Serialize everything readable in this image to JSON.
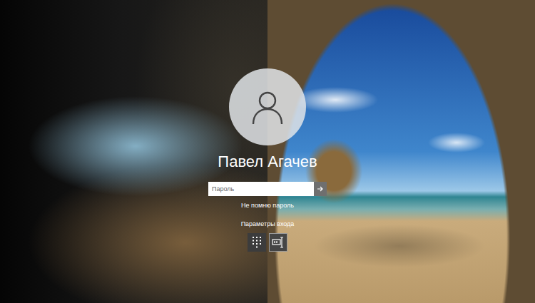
{
  "user": {
    "name": "Павел Агачев"
  },
  "password": {
    "placeholder": "Пароль"
  },
  "forgot_link": "Не помню пароль",
  "sign_in_options": {
    "label": "Параметры входа",
    "options": [
      {
        "kind": "pin",
        "selected": false
      },
      {
        "kind": "password",
        "selected": true
      }
    ]
  }
}
